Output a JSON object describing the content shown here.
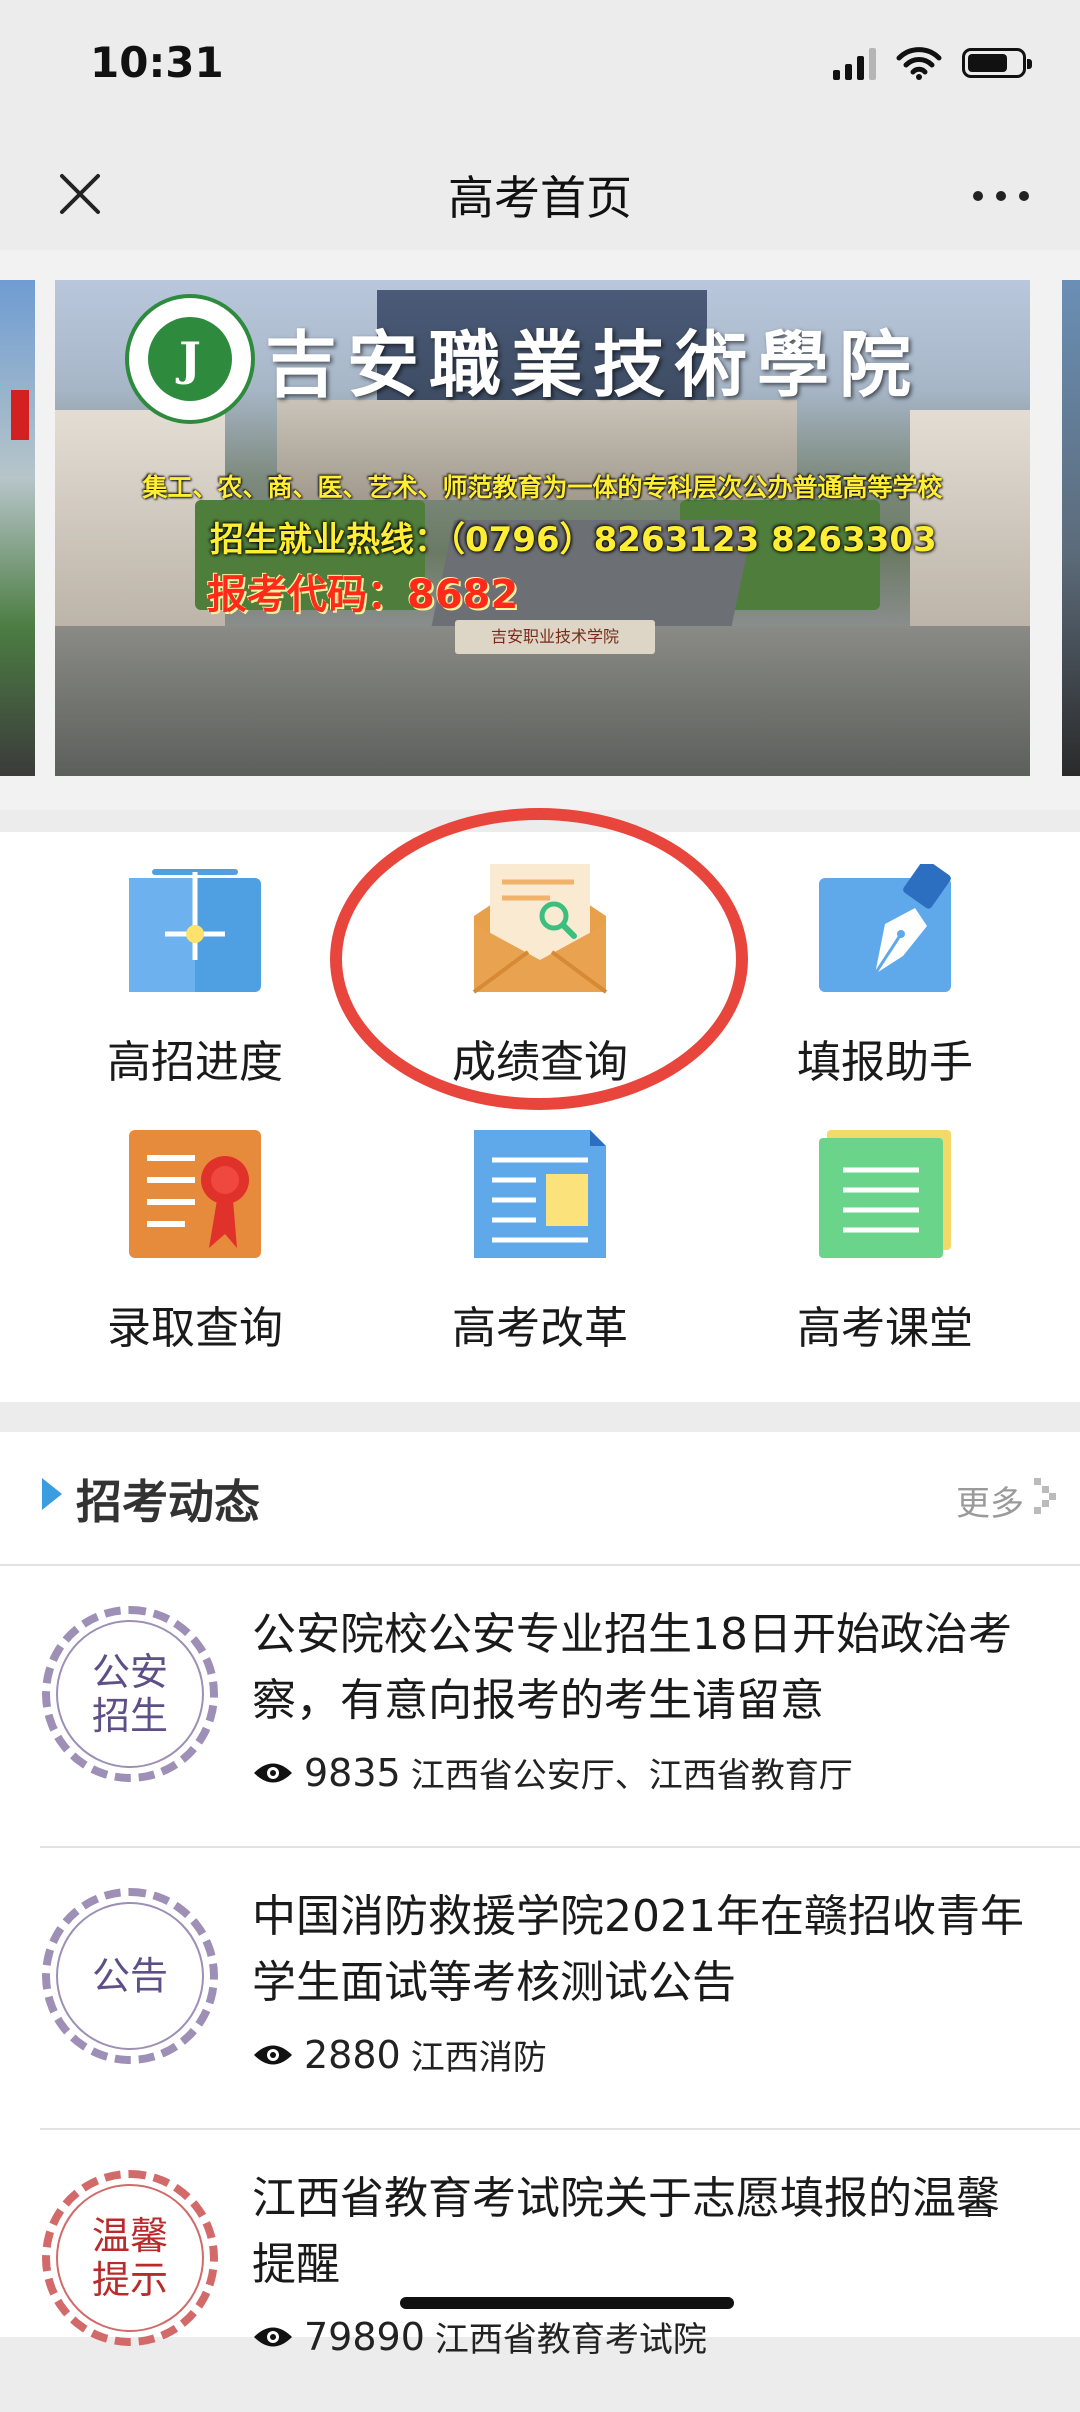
{
  "status_bar": {
    "time": "10:31"
  },
  "nav": {
    "title": "高考首页",
    "close_icon": "close-icon",
    "more_icon": "more-icon"
  },
  "banner": {
    "school_name": "吉安職業技術學院",
    "logo_text": "J",
    "slogan": "集工、农、商、医、艺术、师范教育为一体的专科层次公办普通高等学校",
    "hotline": "招生就业热线：（0796）8263123  8263303",
    "code": "报考代码：8682",
    "plaque": "吉安职业技术学院"
  },
  "menu": {
    "items": [
      {
        "label": "高招进度",
        "icon": "progress-board-icon"
      },
      {
        "label": "成绩查询",
        "icon": "envelope-search-icon"
      },
      {
        "label": "填报助手",
        "icon": "pen-icon"
      },
      {
        "label": "录取查询",
        "icon": "certificate-icon"
      },
      {
        "label": "高考改革",
        "icon": "newspaper-icon"
      },
      {
        "label": "高考课堂",
        "icon": "notebook-icon"
      }
    ]
  },
  "news": {
    "title": "招考动态",
    "more": "更多",
    "items": [
      {
        "badge": "公安\n招生",
        "title": "公安院校公安专业招生18日开始政治考察，有意向报考的考生请留意",
        "views": "9835",
        "source": "江西省公安厅、江西省教育厅"
      },
      {
        "badge": "公告",
        "title": "中国消防救援学院2021年在赣招收青年学生面试等考核测试公告",
        "views": "2880",
        "source": "江西消防"
      },
      {
        "badge": "温馨\n提示",
        "title": "江西省教育考试院关于志愿填报的温馨提醒",
        "views": "79890",
        "source": "江西省教育考试院"
      }
    ]
  },
  "colors": {
    "accent_blue": "#3a9de0",
    "highlight_red": "#e8453c",
    "badge_purple": "#9d8fb5",
    "badge_red": "#d36a6a"
  }
}
